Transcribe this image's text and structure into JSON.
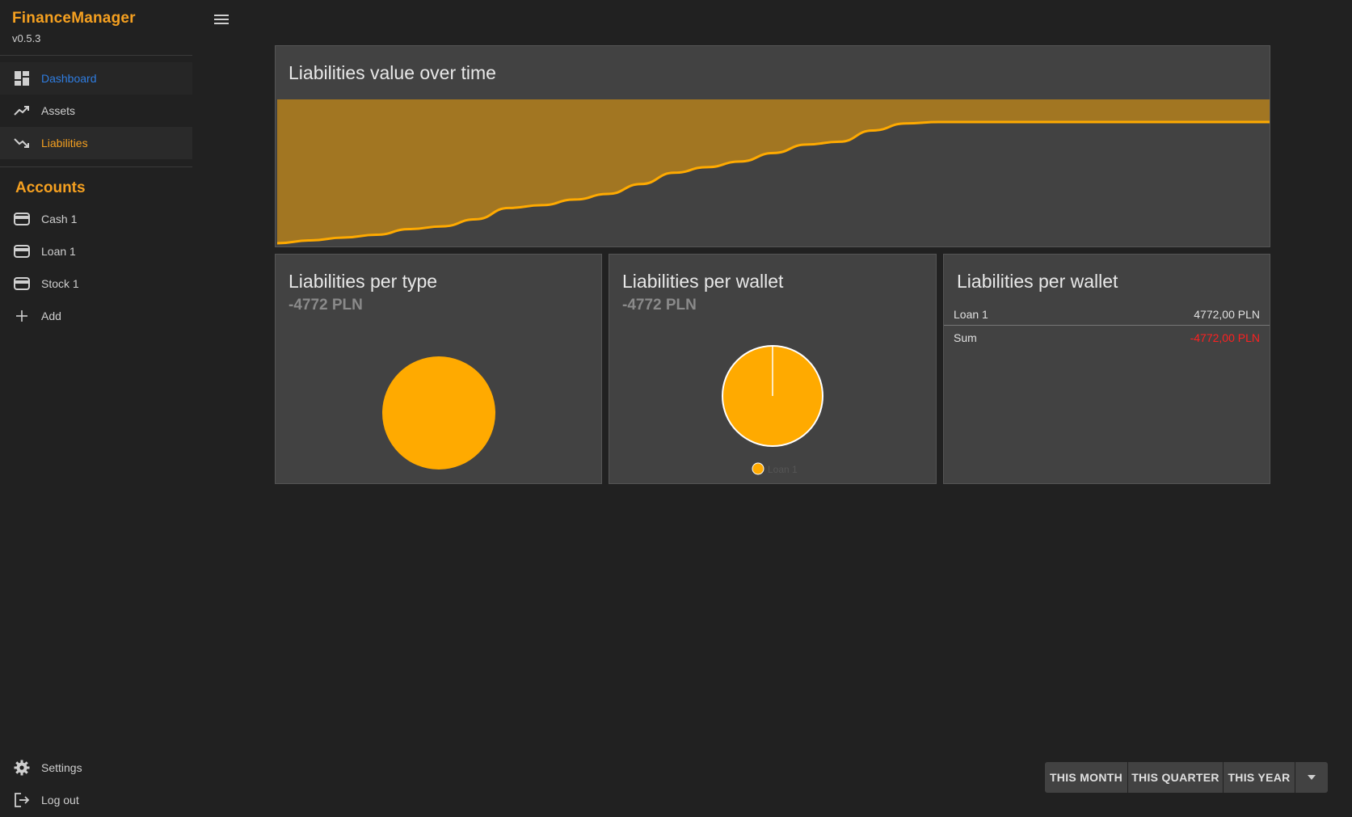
{
  "app": {
    "title": "FinanceManager",
    "version": "v0.5.3"
  },
  "nav": {
    "dashboard": "Dashboard",
    "assets": "Assets",
    "liabilities": "Liabilities"
  },
  "accounts": {
    "header": "Accounts",
    "items": [
      "Cash 1",
      "Loan 1",
      "Stock 1"
    ],
    "add": "Add"
  },
  "bottom_nav": {
    "settings": "Settings",
    "logout": "Log out"
  },
  "cards": {
    "over_time": {
      "title": "Liabilities value over time"
    },
    "per_type": {
      "title": "Liabilities per type",
      "total": "-4772 PLN"
    },
    "per_wallet_chart": {
      "title": "Liabilities per wallet",
      "total": "-4772 PLN"
    },
    "per_wallet_table": {
      "title": "Liabilities per wallet",
      "rows": [
        {
          "name": "Loan 1",
          "value": "4772,00 PLN"
        },
        {
          "name": "Sum",
          "value": "-4772,00 PLN"
        }
      ]
    }
  },
  "range_buttons": [
    "THIS MONTH",
    "THIS QUARTER",
    "THIS YEAR"
  ],
  "colors": {
    "accent": "#f5a020",
    "chart_fill": "#a27622",
    "chart_line": "#ffaa00",
    "pie": "#ffaa00",
    "negative": "#ff2020",
    "nav_selected": "#2f7de1"
  },
  "icons": {
    "menu": "hamburger-menu-icon",
    "dashboard": "dashboard-icon",
    "assets": "trending-up-icon",
    "liabilities": "trending-down-icon",
    "wallet": "wallet-icon",
    "add": "plus-icon",
    "settings": "gear-icon",
    "logout": "logout-icon",
    "dropdown": "caret-down-icon"
  },
  "chart_data": [
    {
      "type": "area",
      "title": "Liabilities value over time",
      "x": [
        0,
        1,
        2,
        3,
        4,
        5,
        6,
        7,
        8,
        9,
        10,
        11,
        12,
        13,
        14,
        15,
        16,
        17,
        18,
        19,
        20,
        21,
        22,
        23,
        24,
        25,
        26,
        27,
        28,
        29,
        30
      ],
      "values": [
        0.0,
        0.02,
        0.04,
        0.06,
        0.1,
        0.12,
        0.17,
        0.25,
        0.27,
        0.31,
        0.35,
        0.42,
        0.5,
        0.54,
        0.58,
        0.64,
        0.7,
        0.72,
        0.8,
        0.85,
        0.86,
        0.86,
        0.86,
        0.86,
        0.86,
        0.86,
        0.86,
        0.86,
        0.86,
        0.86,
        0.86
      ],
      "grid": false,
      "legend": "none"
    },
    {
      "type": "pie",
      "title": "Liabilities per type",
      "values": [
        4772
      ]
    },
    {
      "type": "pie",
      "title": "Liabilities per wallet",
      "categories": [
        "Loan 1"
      ],
      "values": [
        4772
      ],
      "legend": "bottom"
    }
  ]
}
